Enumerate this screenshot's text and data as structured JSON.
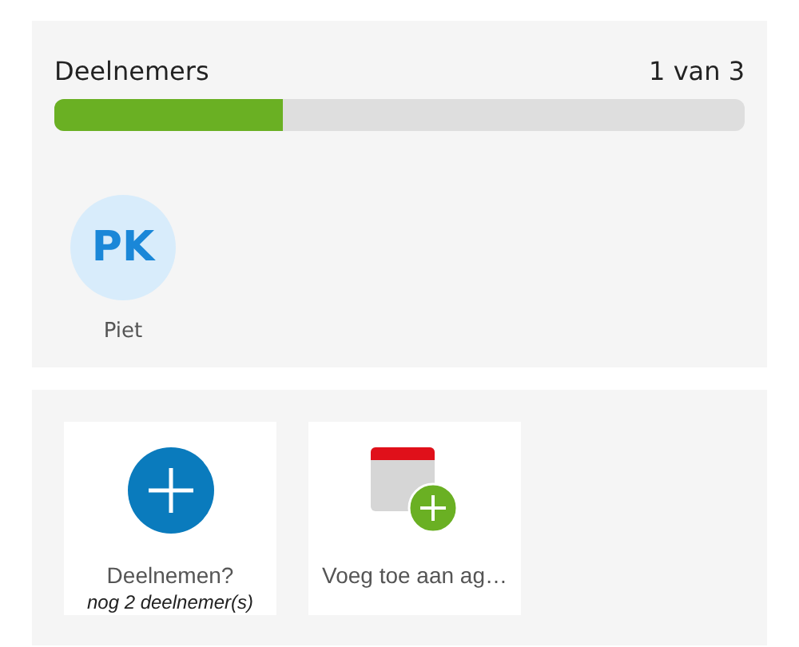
{
  "participants": {
    "title": "Deelnemers",
    "count": "1 van 3",
    "level": 0.33,
    "people": [
      {
        "initials": "PK",
        "name": "Piet"
      }
    ]
  },
  "actions": [
    {
      "kind": "join",
      "label": "Deelnemen?",
      "sublabel": "nog 2 deelnemer(s)"
    },
    {
      "kind": "calendar",
      "label": "Voeg toe aan ag…"
    }
  ]
}
